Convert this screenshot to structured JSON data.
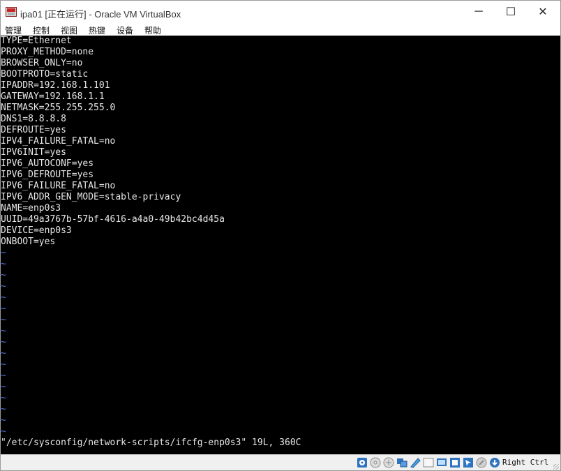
{
  "window": {
    "title": "ipa01 [正在运行] - Oracle VM VirtualBox",
    "controls": {
      "minimize": "─",
      "maximize": "☐",
      "close": "✕"
    }
  },
  "menu": {
    "items": [
      {
        "label": "管理"
      },
      {
        "label": "控制"
      },
      {
        "label": "视图"
      },
      {
        "label": "热键"
      },
      {
        "label": "设备"
      },
      {
        "label": "帮助"
      }
    ]
  },
  "terminal": {
    "lines": [
      "TYPE=Ethernet",
      "PROXY_METHOD=none",
      "BROWSER_ONLY=no",
      "BOOTPROTO=static",
      "IPADDR=192.168.1.101",
      "GATEWAY=192.168.1.1",
      "NETMASK=255.255.255.0",
      "DNS1=8.8.8.8",
      "DEFROUTE=yes",
      "IPV4_FAILURE_FATAL=no",
      "IPV6INIT=yes",
      "IPV6_AUTOCONF=yes",
      "IPV6_DEFROUTE=yes",
      "IPV6_FAILURE_FATAL=no",
      "IPV6_ADDR_GEN_MODE=stable-privacy",
      "NAME=enp0s3",
      "UUID=49a3767b-57bf-4616-a4a0-49b42bc4d45a",
      "DEVICE=enp0s3",
      "ONBOOT=yes"
    ],
    "tilde": "~",
    "tilde_count": 17,
    "status_line": "\"/etc/sysconfig/network-scripts/ifcfg-enp0s3\" 19L, 360C"
  },
  "statusbar": {
    "icons": [
      "hard-disk-icon",
      "optical-drive-icon",
      "network-icon",
      "usb-icon",
      "shared-folders-icon",
      "display-icon",
      "video-capture-icon",
      "cpu-icon",
      "mouse-integration-icon",
      "keyboard-capture-icon"
    ],
    "host_key": "Right Ctrl"
  },
  "colors": {
    "terminal_bg": "#000000",
    "terminal_text": "#e6e6e6",
    "tilde": "#5c73e8"
  }
}
